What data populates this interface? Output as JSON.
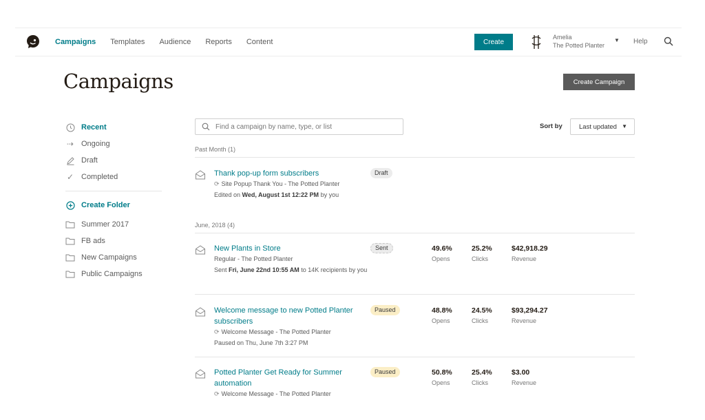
{
  "nav": {
    "items": [
      "Campaigns",
      "Templates",
      "Audience",
      "Reports",
      "Content"
    ],
    "create_label": "Create",
    "account_name": "Amelia",
    "account_org": "The Potted Planter",
    "help_label": "Help"
  },
  "page": {
    "title": "Campaigns",
    "create_campaign_label": "Create Campaign"
  },
  "sidebar": {
    "filters": [
      "Recent",
      "Ongoing",
      "Draft",
      "Completed"
    ],
    "create_folder_label": "Create Folder",
    "folders": [
      "Summer 2017",
      "FB ads",
      "New Campaigns",
      "Public Campaigns"
    ]
  },
  "search": {
    "placeholder": "Find a campaign by name, type, or list"
  },
  "sort": {
    "label": "Sort by",
    "value": "Last updated"
  },
  "groups": {
    "past_month": "Past Month (1)",
    "june": "June, 2018 (4)"
  },
  "campaigns": [
    {
      "name": "Thank pop-up form subscribers",
      "type_line": "Site Popup Thank You - The Potted Planter",
      "status_pre": "Edited on ",
      "status_bold": "Wed, August 1st 12:22 PM",
      "status_post": " by you",
      "badge": "Draft"
    },
    {
      "name": "New Plants in Store",
      "type_line": "Regular - The Potted Planter",
      "status_pre": "Sent ",
      "status_bold": "Fri, June 22nd 10:55 AM",
      "status_post": " to 14K recipients by you",
      "badge": "Sent",
      "opens": "49.6%",
      "clicks": "25.2%",
      "revenue": "$42,918.29"
    },
    {
      "name": "Welcome message to new Potted Planter subscribers",
      "type_line": "Welcome Message - The Potted Planter",
      "status_pre": "Paused on ",
      "status_bold": "Thu, June 7th 3:27 PM",
      "status_post": "",
      "badge": "Paused",
      "opens": "48.8%",
      "clicks": "24.5%",
      "revenue": "$93,294.27"
    },
    {
      "name": "Potted Planter Get Ready for Summer automation",
      "type_line": "Welcome Message - The Potted Planter",
      "badge": "Paused",
      "opens": "50.8%",
      "clicks": "25.4%",
      "revenue": "$3.00"
    }
  ],
  "stat_labels": {
    "opens": "Opens",
    "clicks": "Clicks",
    "revenue": "Revenue"
  },
  "colors": {
    "accent": "#007c89",
    "paused": "#fbeec6",
    "neutral_badge": "#ececec"
  }
}
